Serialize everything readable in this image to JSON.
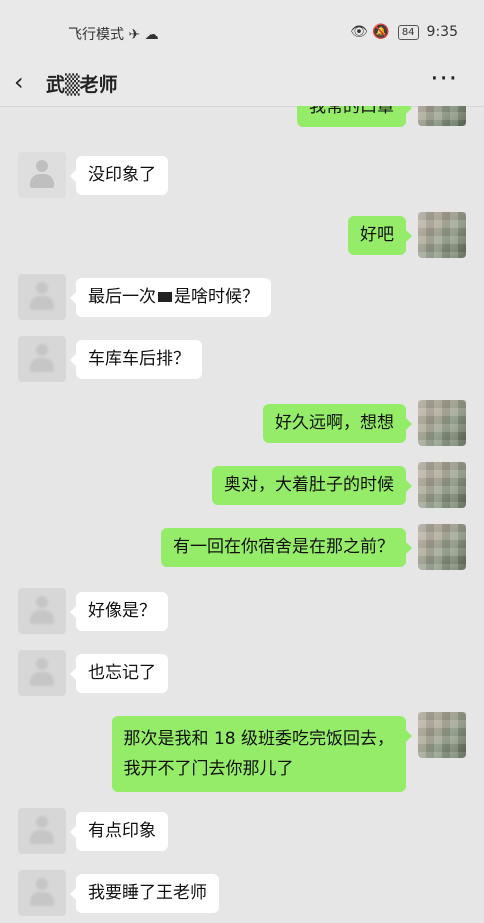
{
  "status": {
    "left": "飞行模式 ✈ ☁",
    "right_icons": "👁 🔕",
    "battery": "84",
    "time": "9:35"
  },
  "header": {
    "back_icon": "chevron-left",
    "title": "武▒老师",
    "more_icon": "more-dots"
  },
  "colors": {
    "bg": "#e6e6e6",
    "outgoing": "#95ec69",
    "incoming": "#ffffff"
  },
  "messages": [
    {
      "side": "right",
      "text": "我常的口罩"
    },
    {
      "side": "left",
      "text": "没印象了"
    },
    {
      "side": "right",
      "text": "好吧"
    },
    {
      "side": "left",
      "text_before": "最后一次",
      "text_after": "是啥时候？"
    },
    {
      "side": "left",
      "text": "车库车后排？"
    },
    {
      "side": "right",
      "text": "好久远啊，想想"
    },
    {
      "side": "right",
      "text": "奥对，大着肚子的时候"
    },
    {
      "side": "right",
      "text": "有一回在你宿舍是在那之前？"
    },
    {
      "side": "left",
      "text": "好像是？"
    },
    {
      "side": "left",
      "text": "也忘记了"
    },
    {
      "side": "right",
      "line1": "那次是我和 18 级班委吃完饭回去，",
      "line2": "我开不了门去你那儿了"
    },
    {
      "side": "left",
      "text": "有点印象"
    },
    {
      "side": "left",
      "text": "我要睡了王老师"
    }
  ]
}
